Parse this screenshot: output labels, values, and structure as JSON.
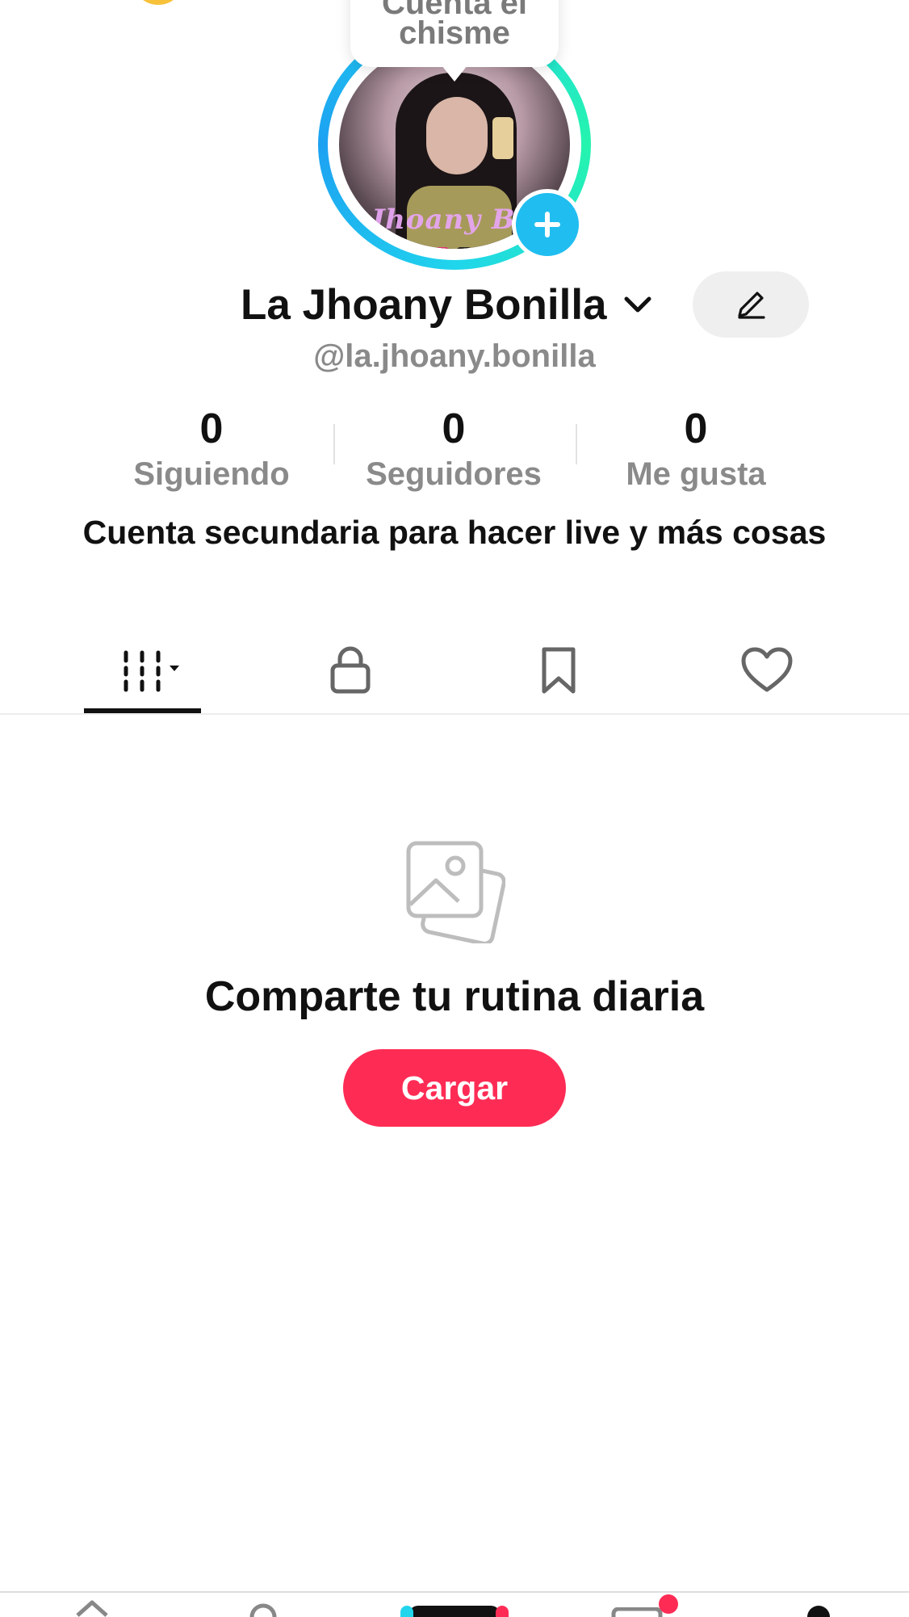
{
  "top": {
    "left_fragment": "••",
    "right_fragment": "• •"
  },
  "note": {
    "line1": "Cuenta el",
    "line2": "chisme"
  },
  "avatar": {
    "watermark": "Jhoany Bo"
  },
  "profile": {
    "display_name": "La Jhoany Bonilla",
    "username": "@la.jhoany.bonilla",
    "bio": "Cuenta secundaria para hacer live y más cosas"
  },
  "stats": [
    {
      "value": "0",
      "label": "Siguiendo"
    },
    {
      "value": "0",
      "label": "Seguidores"
    },
    {
      "value": "0",
      "label": "Me gusta"
    }
  ],
  "tabs": [
    {
      "icon": "videos-grid-icon",
      "active": true
    },
    {
      "icon": "lock-icon",
      "active": false
    },
    {
      "icon": "bookmark-icon",
      "active": false
    },
    {
      "icon": "heart-icon",
      "active": false
    }
  ],
  "empty_state": {
    "icon": "photo-stack-icon",
    "title": "Comparte tu rutina diaria",
    "button": "Cargar"
  },
  "colors": {
    "accent": "#fe2c55",
    "plus_button": "#20bdf0",
    "muted_text": "#8a8a8a",
    "notification_dot": "#fe2c55"
  },
  "bottom_nav": [
    "home-icon",
    "search-icon",
    "create-icon",
    "inbox-icon",
    "profile-icon"
  ]
}
